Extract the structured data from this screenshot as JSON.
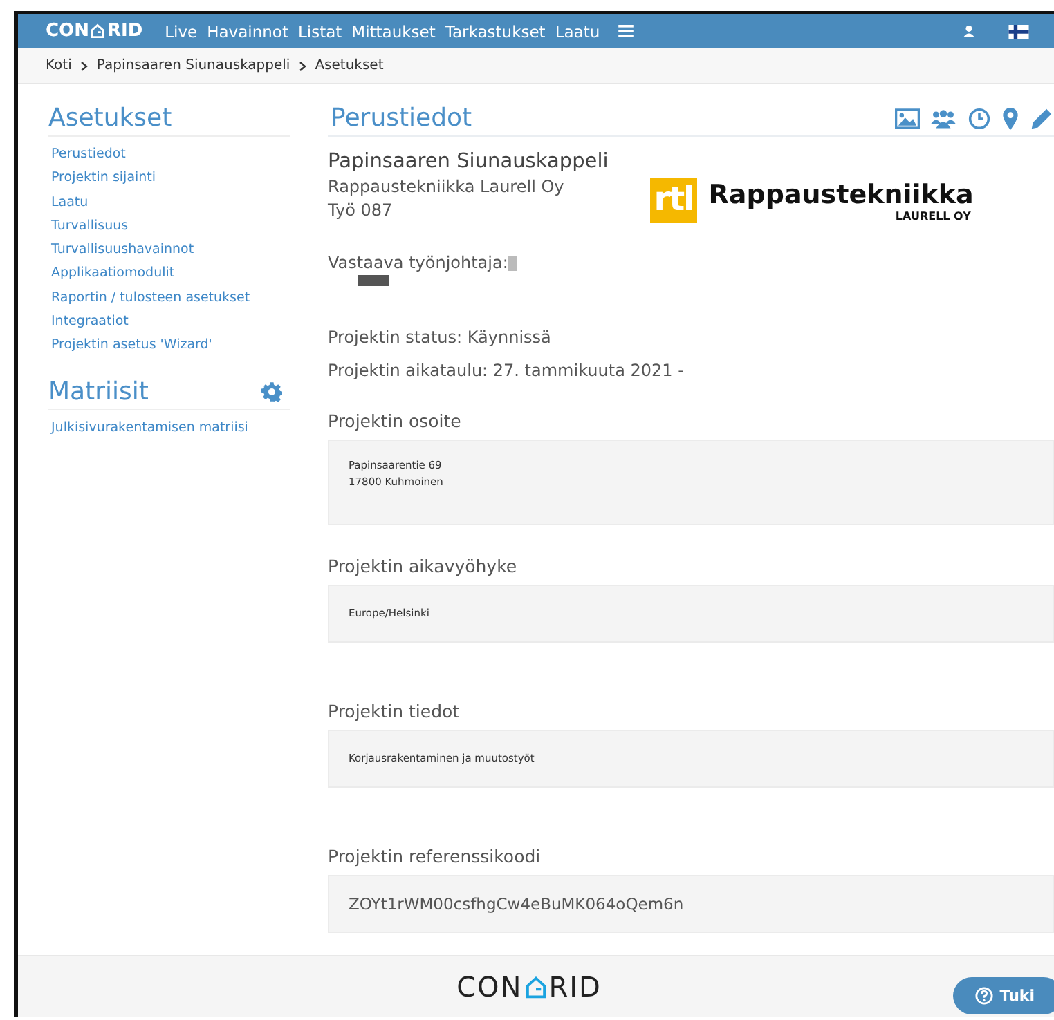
{
  "navbar": {
    "logo": {
      "before": "CON",
      "after": "RID"
    },
    "links": [
      "Live",
      "Havainnot",
      "Listat",
      "Mittaukset",
      "Tarkastukset",
      "Laatu"
    ]
  },
  "breadcrumb": [
    "Koti",
    "Papinsaaren Siunauskappeli",
    "Asetukset"
  ],
  "sidebar": {
    "sections": [
      {
        "title": "Asetukset",
        "kind": "plain",
        "items": [
          "Perustiedot",
          "Projektin sijainti",
          "Laatu",
          "Turvallisuus",
          "Turvallisuushavainnot",
          "Applikaatiomodulit",
          "Raportin / tulosteen asetukset",
          "Integraatiot",
          "Projektin asetus 'Wizard'"
        ]
      },
      {
        "title": "Matriisit",
        "kind": "with_settings",
        "items": [
          "Julkisivurakentamisen matriisi"
        ]
      }
    ]
  },
  "main": {
    "title": "Perustiedot",
    "project_name": "Papinsaaren Siunauskappeli",
    "company": "Rappaustekniikka Laurell Oy",
    "job": "Työ 087",
    "company_logo": {
      "mark": "rtl",
      "name": "Rappaustekniikka",
      "sub": "LAURELL OY"
    },
    "supervisor_label": "Vastaava työnjohtaja:",
    "status": "Projektin status: Käynnissä",
    "schedule": "Projektin aikataulu: 27. tammikuuta 2021 -",
    "fields": [
      {
        "label": "Projektin osoite",
        "lines": [
          "Papinsaarentie 69",
          "17800 Kuhmoinen"
        ],
        "kind": "note"
      },
      {
        "label": "Projektin aikavyöhyke",
        "lines": [
          "Europe/Helsinki"
        ],
        "kind": "note"
      },
      {
        "label": "Projektin tiedot",
        "lines": [
          "Korjausrakentaminen ja muutostyöt"
        ],
        "kind": "note"
      },
      {
        "label": "Projektin referenssikoodi",
        "lines": [
          "ZOYt1rWM00csfhgCw4eBuMK064oQem6n"
        ],
        "kind": "code"
      }
    ]
  },
  "footer": {
    "logo": {
      "before": "CON",
      "after": "RID"
    },
    "help_button": "Tuki"
  }
}
